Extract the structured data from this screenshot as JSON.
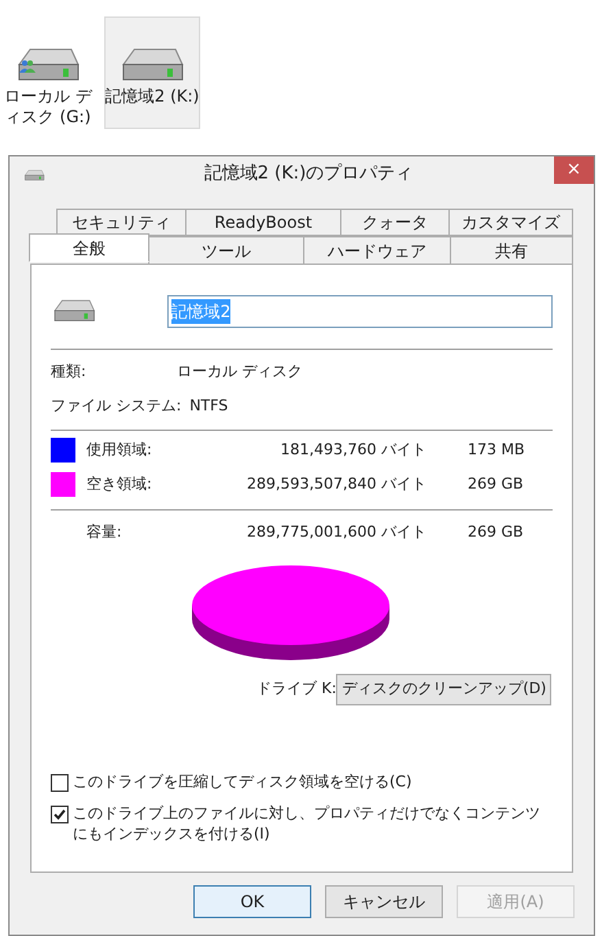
{
  "desktop_icons": [
    {
      "label": "ローカル ディスク (G:)",
      "selected": false,
      "shared": true
    },
    {
      "label": "記憶域2 (K:)",
      "selected": true,
      "shared": false
    }
  ],
  "dialog": {
    "title": "記憶域2 (K:)のプロパティ",
    "close": "×"
  },
  "tab_rows": [
    [
      {
        "label": "セキュリティ",
        "selected": false
      },
      {
        "label": "ReadyBoost",
        "selected": false
      },
      {
        "label": "クォータ",
        "selected": false
      },
      {
        "label": "カスタマイズ",
        "selected": false
      }
    ],
    [
      {
        "label": "全般",
        "selected": true
      },
      {
        "label": "ツール",
        "selected": false
      },
      {
        "label": "ハードウェア",
        "selected": false
      },
      {
        "label": "共有",
        "selected": false
      }
    ]
  ],
  "name_field": {
    "value": "記憶域2",
    "text_selected": true
  },
  "info": [
    {
      "label": "種類:",
      "value": "ローカル ディスク"
    },
    {
      "label": "ファイル システム:",
      "value": "NTFS"
    }
  ],
  "usage": [
    {
      "label": "使用領域:",
      "bytes": "181,493,760 バイト",
      "size": "173 MB",
      "color": "#0000ff"
    },
    {
      "label": "空き領域:",
      "bytes": "289,593,507,840 バイト",
      "size": "269 GB",
      "color": "#ff00ff"
    }
  ],
  "capacity": {
    "label": "容量:",
    "bytes": "289,775,001,600 バイト",
    "size": "269 GB"
  },
  "drive_label": "ドライブ K:",
  "cleanup_button": "ディスクのクリーンアップ(D)",
  "checkboxes": [
    {
      "label": "このドライブを圧縮してディスク領域を空ける(C)",
      "checked": false
    },
    {
      "label": "このドライブ上のファイルに対し、プロパティだけでなくコンテンツにもインデックスを付ける(I)",
      "checked": true
    }
  ],
  "buttons": [
    {
      "label": "OK",
      "default": true,
      "disabled": false
    },
    {
      "label": "キャンセル",
      "default": false,
      "disabled": false
    },
    {
      "label": "適用(A)",
      "default": false,
      "disabled": true
    }
  ]
}
